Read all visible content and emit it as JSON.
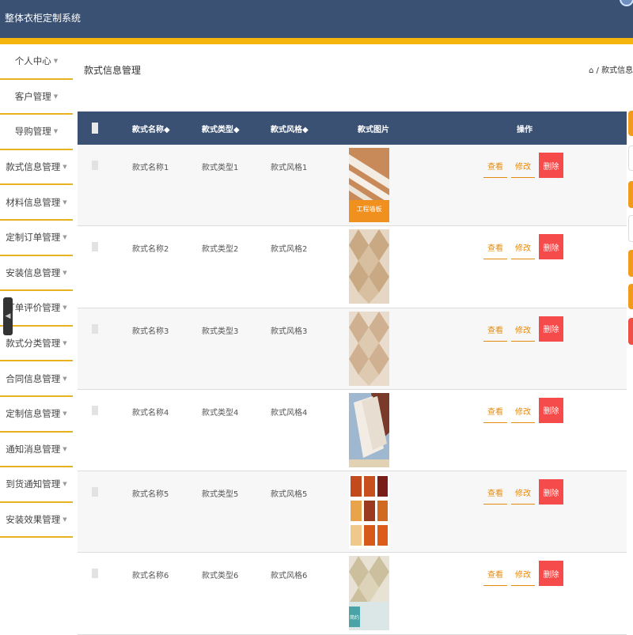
{
  "header": {
    "title": "整体衣柜定制系统"
  },
  "sidebar": {
    "items": [
      {
        "label": "个人中心"
      },
      {
        "label": "客户管理"
      },
      {
        "label": "导购管理"
      },
      {
        "label": "款式信息管理"
      },
      {
        "label": "材料信息管理"
      },
      {
        "label": "定制订单管理"
      },
      {
        "label": "安装信息管理"
      },
      {
        "label": "订单评价管理"
      },
      {
        "label": "款式分类管理"
      },
      {
        "label": "合同信息管理"
      },
      {
        "label": "定制信息管理"
      },
      {
        "label": "通知消息管理"
      },
      {
        "label": "到货通知管理"
      },
      {
        "label": "安装效果管理"
      }
    ],
    "caret": "▼",
    "collapse_icon": "◀"
  },
  "main": {
    "title": "款式信息管理",
    "breadcrumb": "⌂ / 款式信息管理"
  },
  "table": {
    "headers": {
      "name": "款式名称◆",
      "type": "款式类型◆",
      "style": "款式风格◆",
      "image": "款式图片",
      "actions": "操作"
    },
    "actions": {
      "view": "查看",
      "edit": "修改",
      "delete": "删除"
    },
    "rows": [
      {
        "name": "款式名称1",
        "type": "款式类型1",
        "style": "款式风格1",
        "image_caption": "工程墙板"
      },
      {
        "name": "款式名称2",
        "type": "款式类型2",
        "style": "款式风格2"
      },
      {
        "name": "款式名称3",
        "type": "款式类型3",
        "style": "款式风格3"
      },
      {
        "name": "款式名称4",
        "type": "款式类型4",
        "style": "款式风格4"
      },
      {
        "name": "款式名称5",
        "type": "款式类型5",
        "style": "款式风格5"
      },
      {
        "name": "款式名称6",
        "type": "款式类型6",
        "style": "款式风格6",
        "image_caption": "简约"
      }
    ]
  },
  "colors": {
    "header": "#3b5174",
    "accent": "#f5b50c",
    "action": "#e48a0e",
    "danger": "#f54b4b"
  }
}
